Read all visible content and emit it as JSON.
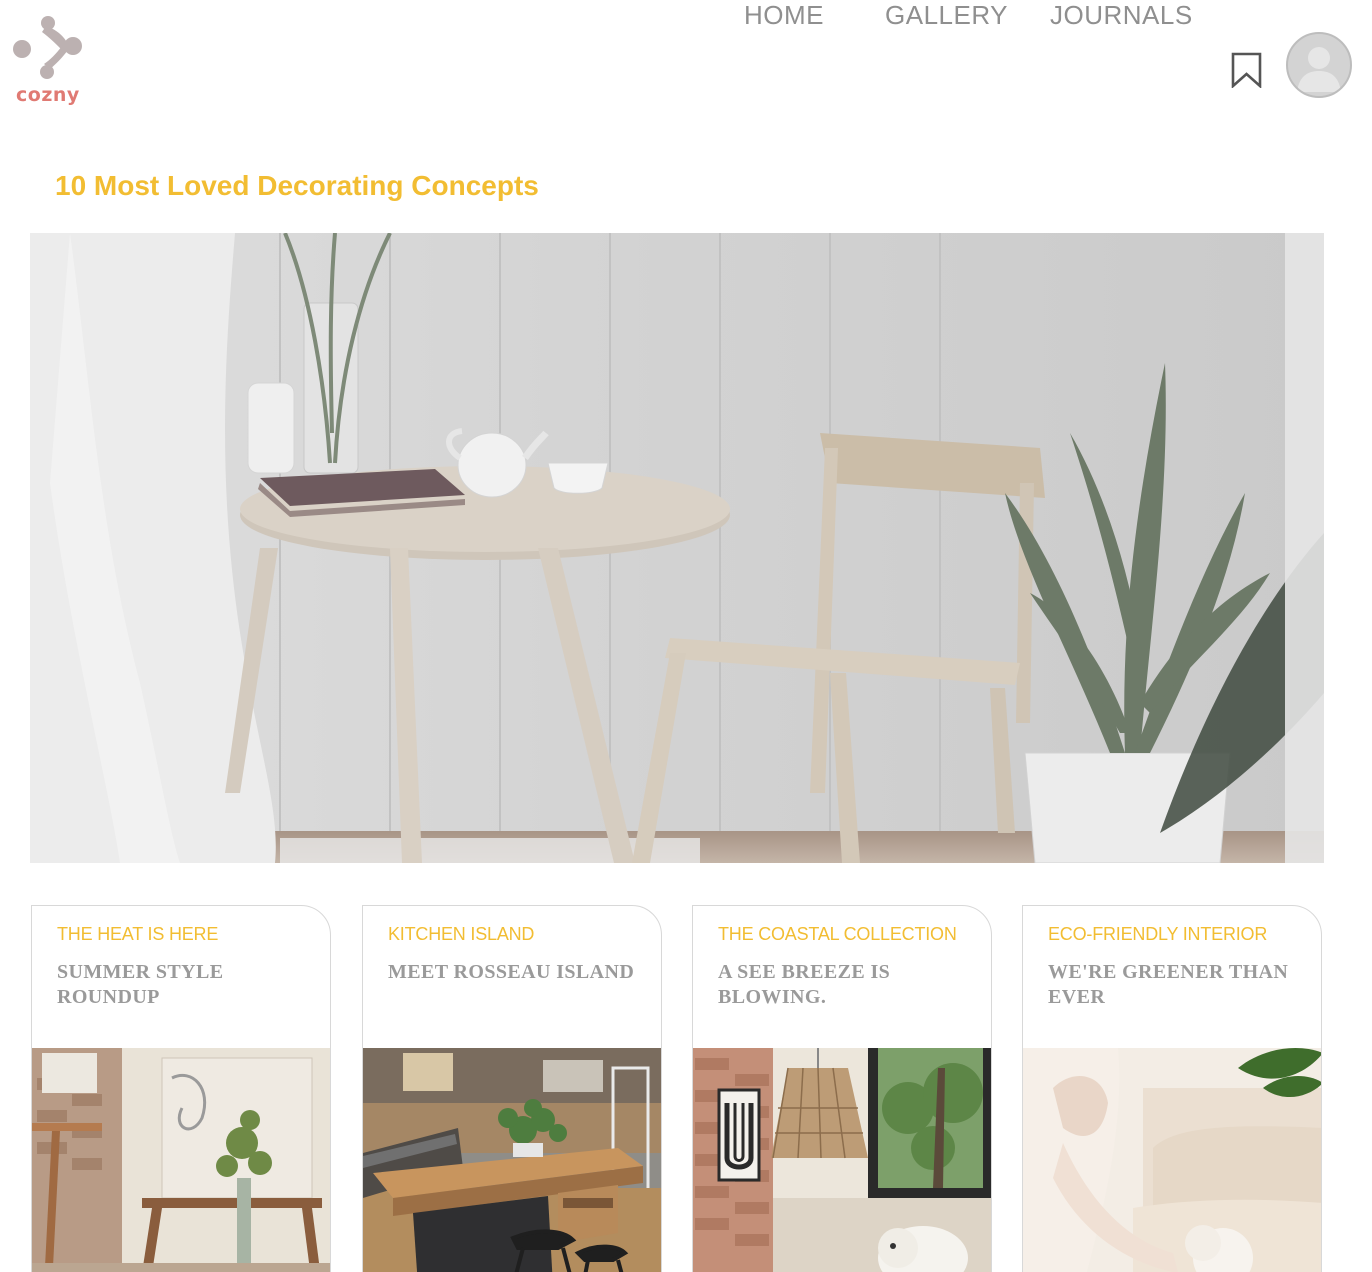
{
  "brand": {
    "name": "cozny",
    "logo_icon": "molecule-dots-logo",
    "logo_dot_color": "#bcb1b1",
    "logo_text_color": "#e07a73"
  },
  "nav": {
    "items": [
      {
        "label": "HOME"
      },
      {
        "label": "GALLERY"
      },
      {
        "label": "JOURNALS"
      }
    ],
    "bookmark_icon": "bookmark-icon",
    "avatar_icon": "user-avatar-icon",
    "link_color": "#8f8f8f"
  },
  "featured": {
    "title": "10 Most Loved Decorating Concepts",
    "title_color": "#f2bd32",
    "image": "dining-table-chair-plants-photo"
  },
  "cards": [
    {
      "kicker": "THE HEAT IS HERE",
      "title": "SUMMER STYLE ROUNDUP",
      "image": "studio-workbench-flowers-photo"
    },
    {
      "kicker": "KITCHEN ISLAND",
      "title": "MEET ROSSEAU ISLAND",
      "image": "kitchen-island-stools-photo"
    },
    {
      "kicker": "THE COASTAL COLLECTION",
      "title": "A SEE BREEZE IS BLOWING.",
      "image": "brick-wall-pendant-lamp-photo"
    },
    {
      "kicker": "ECO-FRIENDLY INTERIOR",
      "title": "WE'RE GREENER THAN EVER",
      "image": "sofa-plant-pet-photo"
    }
  ],
  "colors": {
    "accent": "#f2bd32",
    "card_title": "#9a9a9a",
    "border": "#d8d8d8"
  }
}
